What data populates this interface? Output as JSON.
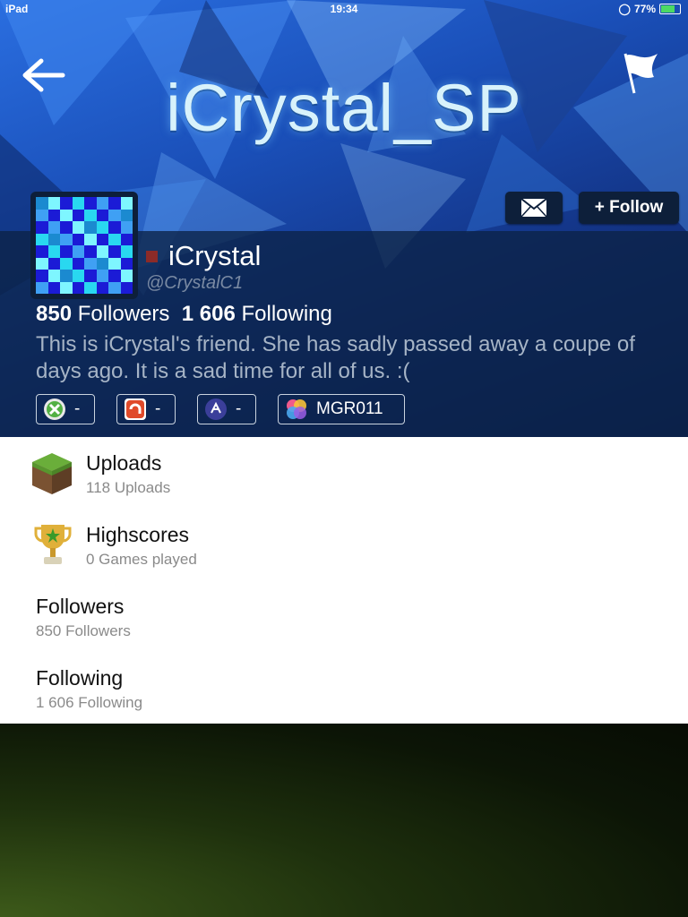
{
  "statusbar": {
    "device": "iPad",
    "time": "19:34",
    "battery": "77%",
    "battery_level": 0.77
  },
  "banner": {
    "title": "iCrystal_SP"
  },
  "actions": {
    "follow_label": "+ Follow"
  },
  "profile": {
    "name": "iCrystal",
    "handle": "@CrystalC1",
    "followers_count": "850",
    "followers_label": "Followers",
    "following_count": "1 606",
    "following_label": "Following",
    "bio": "This is iCrystal's friend. She has sadly passed away a coupe of days ago. It is a sad time for all of us. :(",
    "status_color": "#8c2b28"
  },
  "gamer_tags": [
    {
      "icon": "xbox-icon",
      "value": "-"
    },
    {
      "icon": "psn-icon",
      "value": "-"
    },
    {
      "icon": "nintendo-icon",
      "value": "-"
    },
    {
      "icon": "game-center-icon",
      "value": "MGR011"
    }
  ],
  "menu": [
    {
      "title": "Uploads",
      "subtitle": "118 Uploads",
      "icon": "grass-block-icon"
    },
    {
      "title": "Highscores",
      "subtitle": "0 Games played",
      "icon": "trophy-icon"
    },
    {
      "title": "Followers",
      "subtitle": "850 Followers"
    },
    {
      "title": "Following",
      "subtitle": "1 606 Following"
    }
  ]
}
